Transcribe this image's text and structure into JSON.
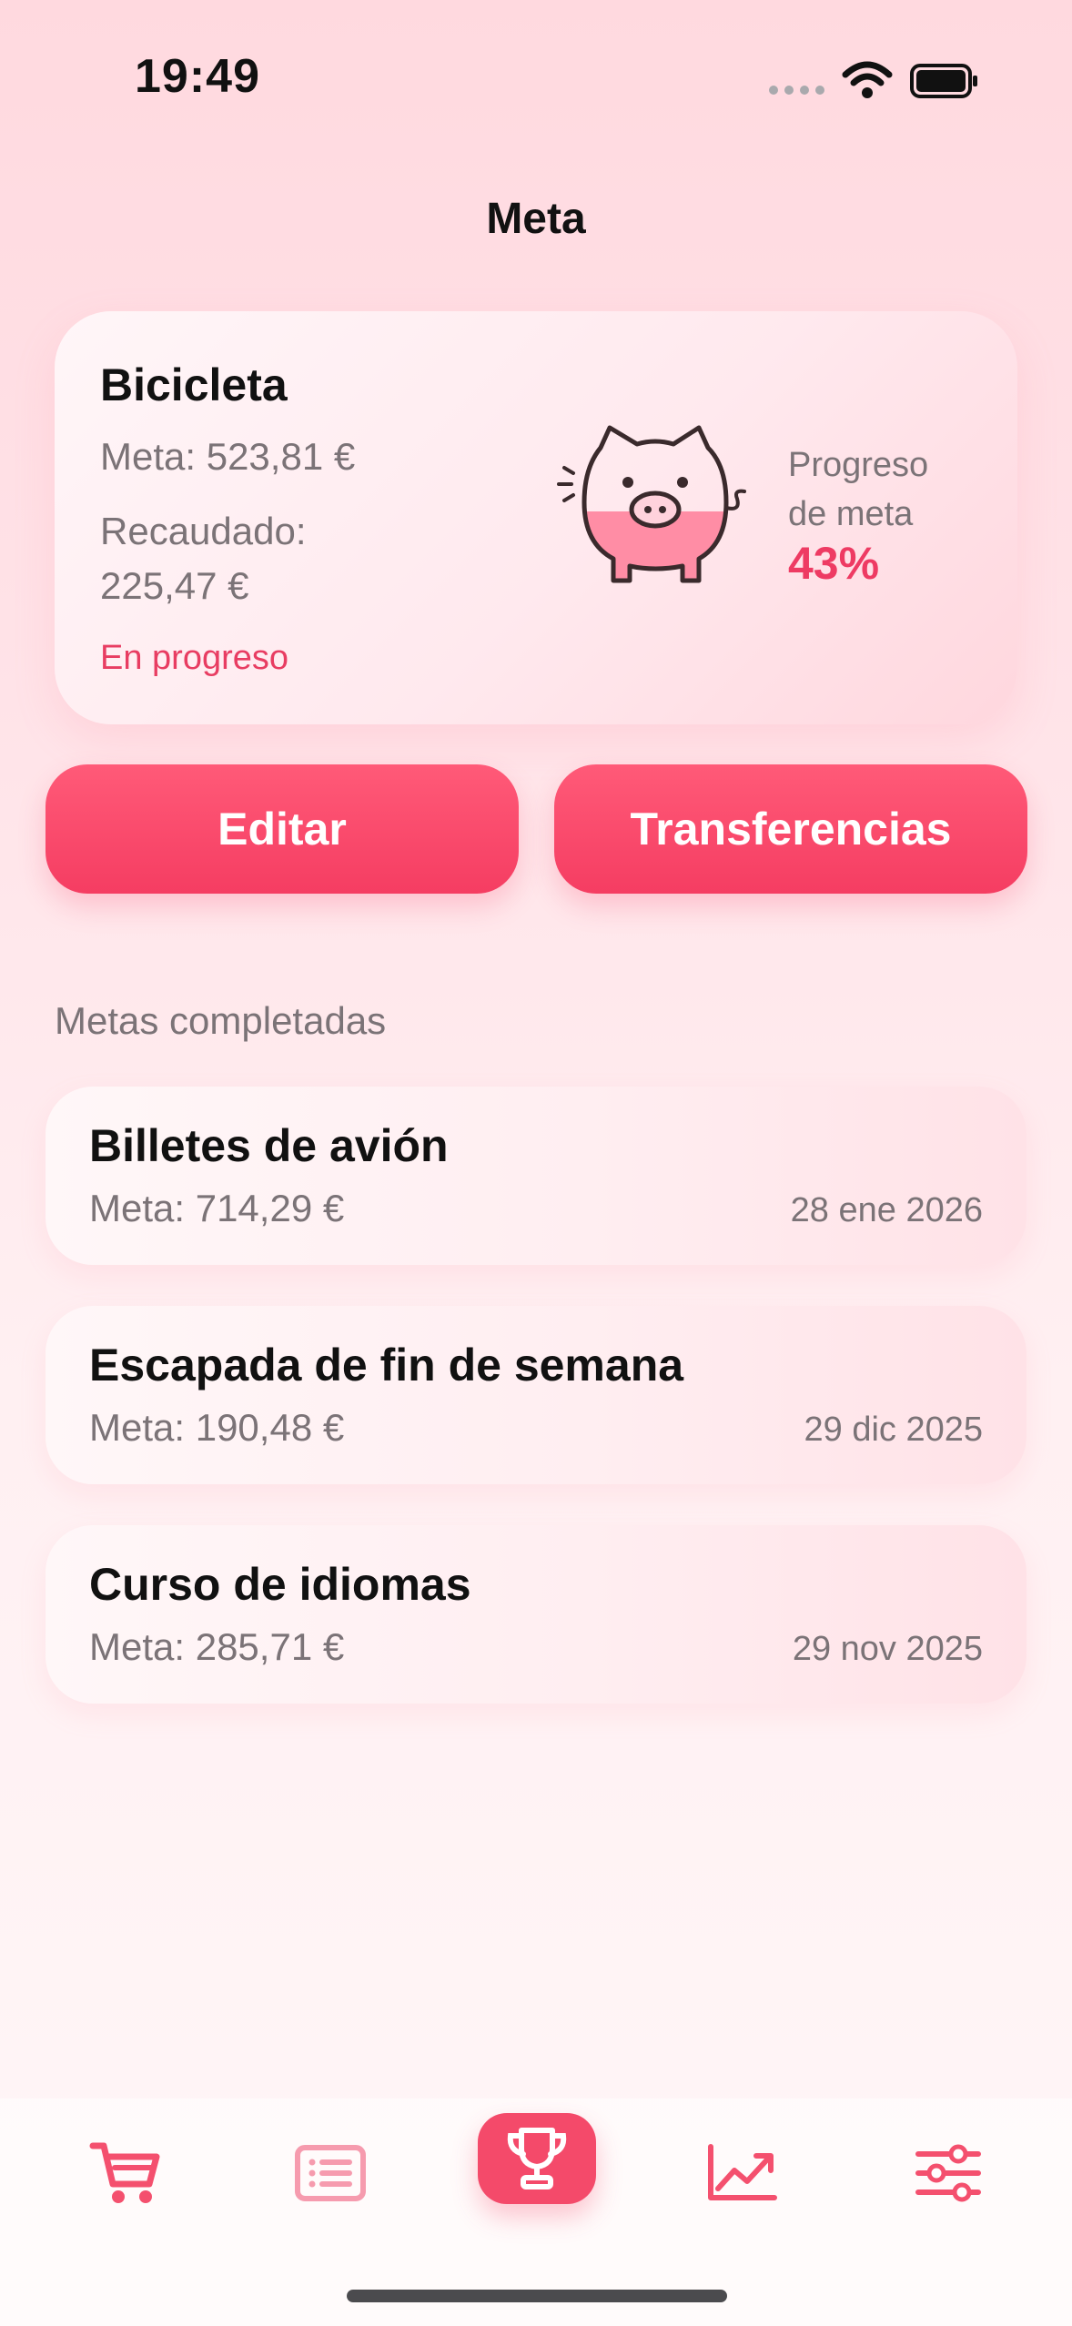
{
  "status": {
    "time": "19:49",
    "icons": [
      "signal-icon",
      "wifi-icon",
      "battery-icon"
    ]
  },
  "header": {
    "title": "Meta"
  },
  "current_goal": {
    "name": "Bicicleta",
    "meta": "Meta: 523,81 €",
    "raised_label": "Recaudado:",
    "raised_value": "225,47 €",
    "status": "En progreso",
    "progress_label": "Progreso de meta",
    "progress_value": "43%",
    "progress_fraction": 0.43,
    "icon": "piggy-bank-icon"
  },
  "actions": {
    "edit": "Editar",
    "transfers": "Transferencias"
  },
  "completed": {
    "title": "Metas completadas",
    "items": [
      {
        "name": "Billetes de avión",
        "meta": "Meta: 714,29 €",
        "date": "28 ene 2026"
      },
      {
        "name": "Escapada de fin de semana",
        "meta": "Meta: 190,48 €",
        "date": "29 dic 2025"
      },
      {
        "name": "Curso de idiomas",
        "meta": "Meta: 285,71 €",
        "date": "29 nov 2025"
      }
    ]
  },
  "tabbar": {
    "items": [
      "cart-icon",
      "list-icon",
      "trophy-icon",
      "chart-icon",
      "sliders-icon"
    ],
    "active": "trophy-icon"
  },
  "colors": {
    "accent": "#f44a6a",
    "text_secondary": "#7b7377",
    "background": "#ffe3e8"
  }
}
